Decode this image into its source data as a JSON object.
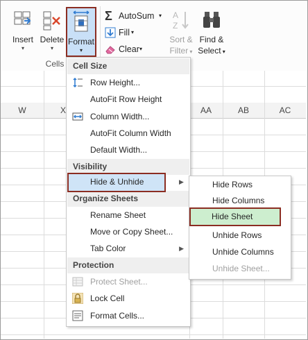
{
  "ribbon": {
    "insert": {
      "label": "Insert",
      "icon": "insert-cells-icon"
    },
    "delete": {
      "label": "Delete",
      "icon": "delete-cells-icon"
    },
    "format": {
      "label": "Format",
      "icon": "format-cells-icon"
    },
    "group_label": "Cells",
    "autosum": {
      "label": "AutoSum",
      "icon": "sigma-icon"
    },
    "fill": {
      "label": "Fill",
      "icon": "fill-down-icon"
    },
    "clear": {
      "label": "Clear",
      "icon": "eraser-icon"
    },
    "sort_filter": {
      "label1": "Sort &",
      "label2": "Filter",
      "icon": "sort-az-icon"
    },
    "find_select": {
      "label1": "Find &",
      "label2": "Select",
      "icon": "binoculars-icon"
    }
  },
  "grid": {
    "columns": [
      "W",
      "X",
      "AA",
      "AB",
      "AC"
    ]
  },
  "format_menu": {
    "sections": {
      "cell_size": "Cell Size",
      "visibility": "Visibility",
      "organize": "Organize Sheets",
      "protection": "Protection"
    },
    "items": {
      "row_height": "Row Height...",
      "autofit_row_height": "AutoFit Row Height",
      "column_width": "Column Width...",
      "autofit_column_width": "AutoFit Column Width",
      "default_width": "Default Width...",
      "hide_unhide": "Hide & Unhide",
      "rename_sheet": "Rename Sheet",
      "move_copy_sheet": "Move or Copy Sheet...",
      "tab_color": "Tab Color",
      "protect_sheet": "Protect Sheet...",
      "lock_cell": "Lock Cell",
      "format_cells": "Format Cells..."
    }
  },
  "hide_unhide_submenu": {
    "hide_rows": "Hide Rows",
    "hide_columns": "Hide Columns",
    "hide_sheet": "Hide Sheet",
    "unhide_rows": "Unhide Rows",
    "unhide_columns": "Unhide Columns",
    "unhide_sheet": "Unhide Sheet..."
  },
  "colors": {
    "highlight_border": "#8b2d22",
    "menu_hover": "#cfe4f7",
    "submenu_hover": "#cdeecf"
  }
}
